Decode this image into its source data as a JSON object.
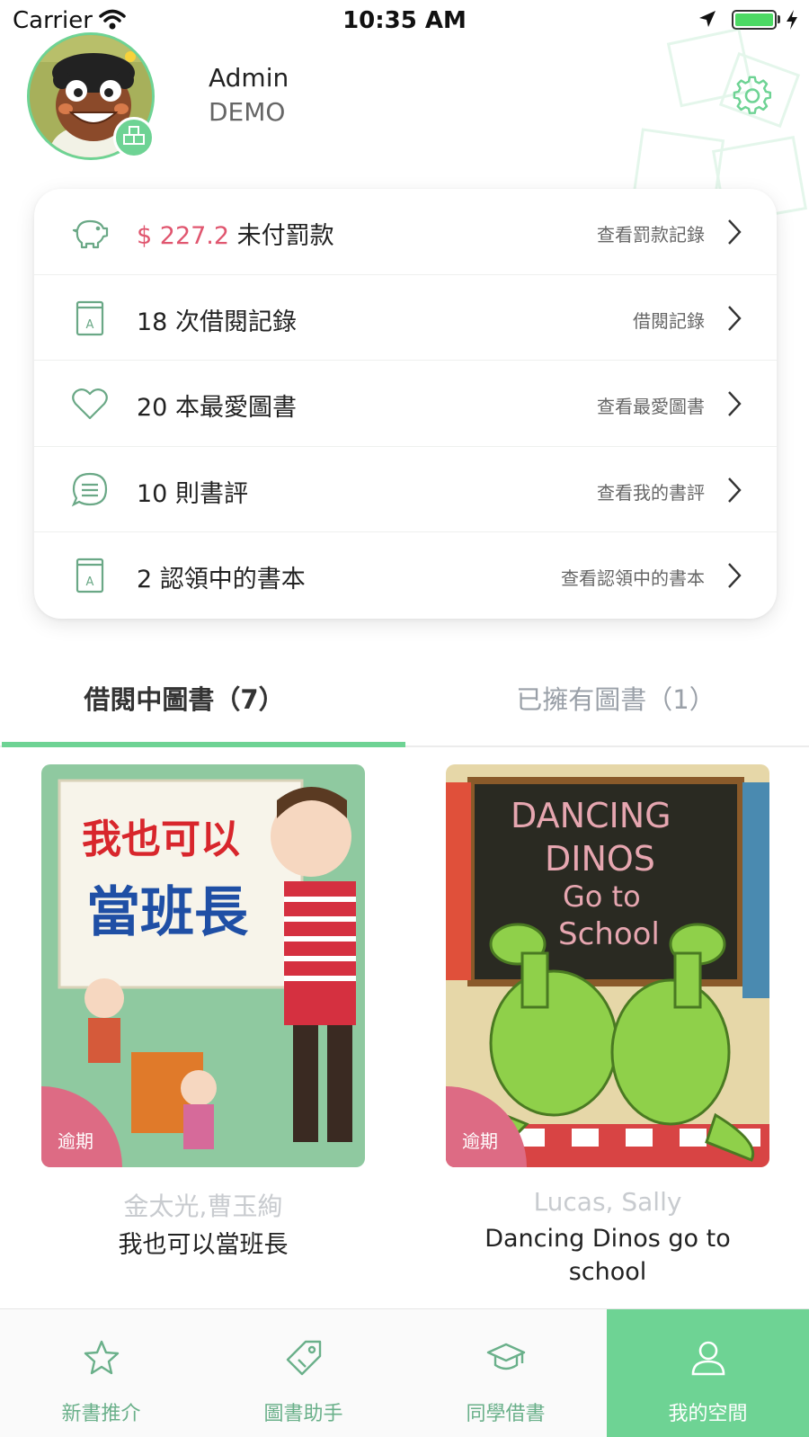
{
  "status_bar": {
    "carrier": "Carrier",
    "time": "10:35 AM",
    "battery_level": 1.0
  },
  "profile": {
    "name": "Admin",
    "org": "DEMO"
  },
  "stats": [
    {
      "icon": "piggy-bank-icon",
      "amount": "$ 227.2",
      "label": " 未付罰款",
      "link": "查看罰款記錄"
    },
    {
      "icon": "book-icon",
      "count": "18",
      "label": " 次借閱記錄",
      "link": "借閱記錄"
    },
    {
      "icon": "heart-icon",
      "count": "20",
      "label": " 本最愛圖書",
      "link": "查看最愛圖書"
    },
    {
      "icon": "chat-bubble-icon",
      "count": "10",
      "label": " 則書評",
      "link": "查看我的書評"
    },
    {
      "icon": "book-icon",
      "count": "2",
      "label": " 認領中的書本",
      "link": "查看認領中的書本"
    }
  ],
  "tabs": {
    "borrowed": "借閱中圖書（7）",
    "owned": "已擁有圖書（1）",
    "active": "borrowed"
  },
  "books": [
    {
      "badge": "逾期",
      "author": "金太光,曹玉絢",
      "title": "我也可以當班長",
      "cover_text_main": "我也可以",
      "cover_text_sub": "當班長"
    },
    {
      "badge": "逾期",
      "author": "Lucas, Sally",
      "title": "Dancing Dinos go to school",
      "cover_lines": [
        "DANCING",
        "DINOS",
        "Go to",
        "School"
      ]
    }
  ],
  "nav": [
    {
      "label": "新書推介",
      "icon": "star-icon",
      "active": false
    },
    {
      "label": "圖書助手",
      "icon": "tag-icon",
      "active": false
    },
    {
      "label": "同學借書",
      "icon": "graduation-cap-icon",
      "active": false
    },
    {
      "label": "我的空間",
      "icon": "person-icon",
      "active": true
    }
  ],
  "colors": {
    "accent": "#6ed394",
    "fine": "#e0566f",
    "overdue_badge": "#dd6b84"
  }
}
